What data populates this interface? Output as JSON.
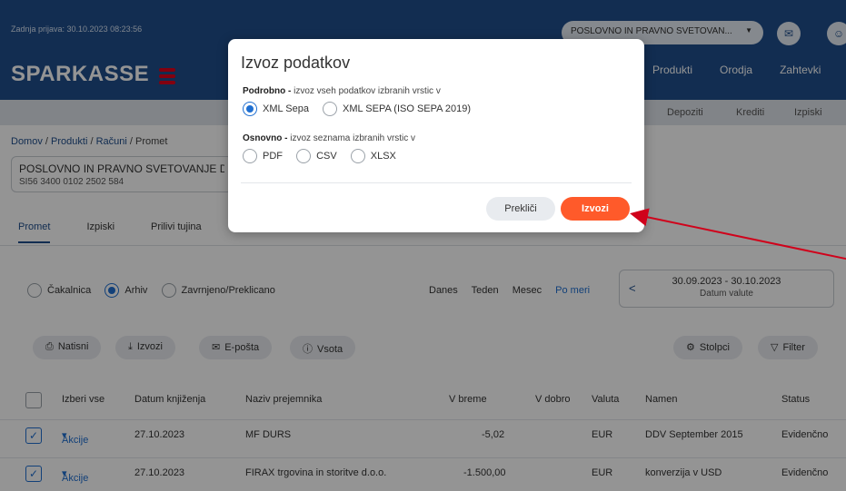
{
  "header": {
    "last_login": "Zadnja prijava: 30.10.2023 08:23:56",
    "client_select": "POSLOVNO IN PRAVNO SVETOVAN...",
    "logo_text": "SPARKASSE",
    "main_nav": [
      "Produkti",
      "Orodja",
      "Zahtevki"
    ],
    "sub_nav": [
      "Depoziti",
      "Krediti",
      "Izpiski"
    ]
  },
  "breadcrumb": {
    "items": [
      "Domov",
      "Produkti",
      "Računi",
      "Promet"
    ],
    "separator": "/"
  },
  "account": {
    "name": "POSLOVNO IN PRAVNO SVETOVANJE D",
    "iban": "SI56 3400 0102 2502 584"
  },
  "tabs": [
    "Promet",
    "Izpiski",
    "Prilivi tujina"
  ],
  "status_filter": {
    "options": [
      "Čakalnica",
      "Arhiv",
      "Zavrnjeno/Preklicano"
    ],
    "selected": "Arhiv"
  },
  "periods": {
    "options": [
      "Danes",
      "Teden",
      "Mesec",
      "Po meri"
    ],
    "selected": "Po meri"
  },
  "date_range": {
    "value": "30.09.2023 - 30.10.2023",
    "label": "Datum valute"
  },
  "toolbar": {
    "print": "Natisni",
    "export": "Izvozi",
    "email": "E-pošta",
    "sum": "Vsota",
    "columns": "Stolpci",
    "filter": "Filter"
  },
  "table": {
    "columns": [
      "Izberi vse",
      "Datum knjiženja",
      "Naziv prejemnika",
      "V breme",
      "V dobro",
      "Valuta",
      "Namen",
      "Status"
    ],
    "rows": [
      {
        "actions": "Akcije",
        "date": "27.10.2023",
        "recipient": "MF DURS",
        "debit": "-5,02",
        "credit": "",
        "currency": "EUR",
        "purpose": "DDV September 2015",
        "status": "Evidenčno"
      },
      {
        "actions": "Akcije",
        "date": "27.10.2023",
        "recipient": "FIRAX trgovina in storitve d.o.o.",
        "debit": "-1.500,00",
        "credit": "",
        "currency": "EUR",
        "purpose": "konverzija v USD",
        "status": "Evidenčno"
      }
    ]
  },
  "modal": {
    "title": "Izvoz podatkov",
    "detailed_bold": "Podrobno -",
    "detailed_text": " izvoz vseh podatkov izbranih vrstic v",
    "detailed_options": [
      "XML Sepa",
      "XML SEPA (ISO SEPA 2019)"
    ],
    "detailed_selected": "XML Sepa",
    "basic_bold": "Osnovno -",
    "basic_text": " izvoz seznama izbranih vrstic v",
    "basic_options": [
      "PDF",
      "CSV",
      "XLSX"
    ],
    "cancel": "Prekliči",
    "confirm": "Izvozi"
  },
  "colors": {
    "brand_blue": "#1f4e8c",
    "accent_orange": "#ff5a2a",
    "radio_blue": "#1f6fd1",
    "annotation_red": "#d0021b"
  }
}
